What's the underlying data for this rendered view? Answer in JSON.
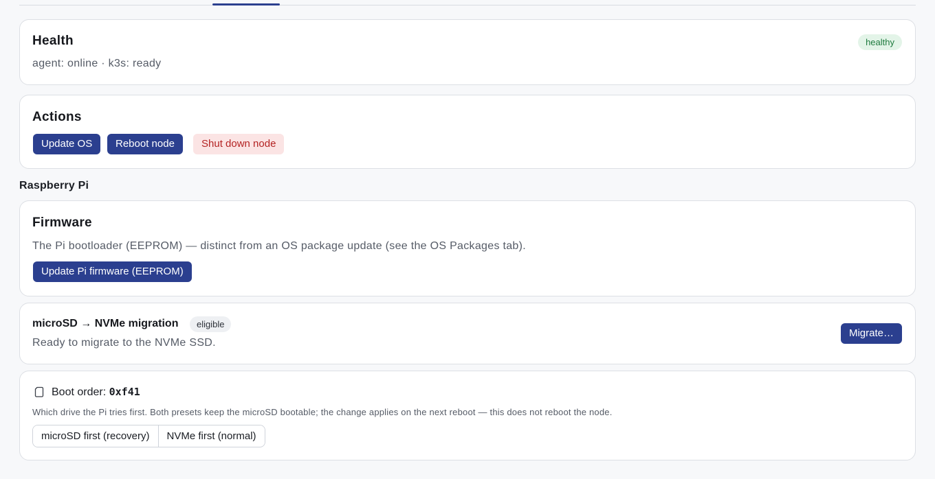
{
  "health": {
    "title": "Health",
    "status_text": "agent: online · k3s: ready",
    "badge": "healthy"
  },
  "actions": {
    "title": "Actions",
    "update_os": "Update OS",
    "reboot": "Reboot node",
    "shutdown": "Shut down node"
  },
  "section_heading": "Raspberry Pi",
  "firmware": {
    "title": "Firmware",
    "description": "The Pi bootloader (EEPROM) — distinct from an OS package update (see the OS Packages tab).",
    "update_button": "Update Pi firmware (EEPROM)"
  },
  "migration": {
    "title": "microSD → NVMe migration",
    "badge": "eligible",
    "description": "Ready to migrate to the NVMe SSD.",
    "button": "Migrate…"
  },
  "boot_order": {
    "label": "Boot order: ",
    "value": "0xf41",
    "description": "Which drive the Pi tries first. Both presets keep the microSD bootable; the change applies on the next reboot — this does not reboot the node.",
    "presets": [
      "microSD first (recovery)",
      "NVMe first (normal)"
    ]
  }
}
